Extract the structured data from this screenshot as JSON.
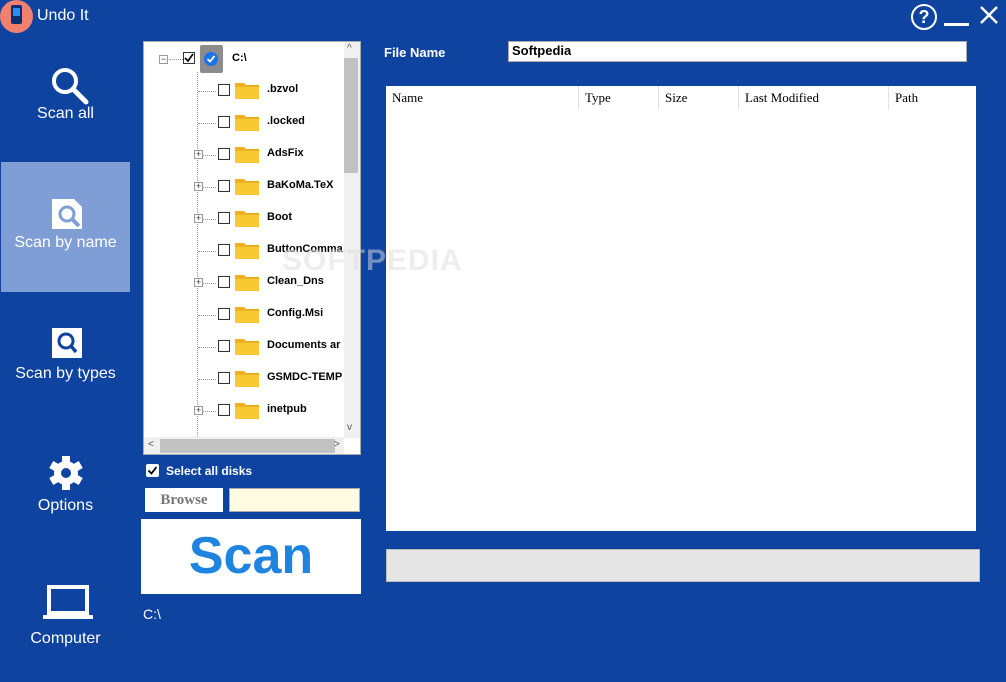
{
  "app": {
    "title": "Undo It"
  },
  "titlebar": {
    "help_glyph": "?"
  },
  "sidebar": {
    "items": [
      {
        "label": "Scan all",
        "icon": "magnifier-icon",
        "active": false
      },
      {
        "label": "Scan by name",
        "icon": "file-search-icon",
        "active": true
      },
      {
        "label": "Scan by types",
        "icon": "search-doc-icon",
        "active": false
      },
      {
        "label": "Options",
        "icon": "gear-icon",
        "active": false
      },
      {
        "label": "Computer",
        "icon": "laptop-icon",
        "active": false
      }
    ]
  },
  "tree": {
    "root": {
      "label": "C:\\",
      "checked": true
    },
    "items": [
      {
        "label": ".bzvol",
        "expandable": false
      },
      {
        "label": ".locked",
        "expandable": false
      },
      {
        "label": "AdsFix",
        "expandable": true
      },
      {
        "label": "BaKoMa.TeX",
        "expandable": true
      },
      {
        "label": "Boot",
        "expandable": true
      },
      {
        "label": "ButtonComma",
        "expandable": false
      },
      {
        "label": "Clean_Dns",
        "expandable": true
      },
      {
        "label": "Config.Msi",
        "expandable": false
      },
      {
        "label": "Documents ar",
        "expandable": false
      },
      {
        "label": "GSMDC-TEMP",
        "expandable": false
      },
      {
        "label": "inetpub",
        "expandable": true
      }
    ]
  },
  "controls": {
    "select_all_label": "Select all disks",
    "select_all_checked": true,
    "browse_label": "Browse",
    "browse_value": "",
    "scan_label": "Scan",
    "current_path": "C:\\"
  },
  "search": {
    "file_name_label": "File Name",
    "file_name_value": "Softpedia"
  },
  "results": {
    "columns": [
      "Name",
      "Type",
      "Size",
      "Last Modified",
      "Path"
    ],
    "rows": []
  },
  "watermark": "SOFTPEDIA",
  "colors": {
    "background": "#0e43a0",
    "active_nav": "#7f9ed5",
    "scan_text": "#1f84e0",
    "folder": "#f9c933"
  }
}
